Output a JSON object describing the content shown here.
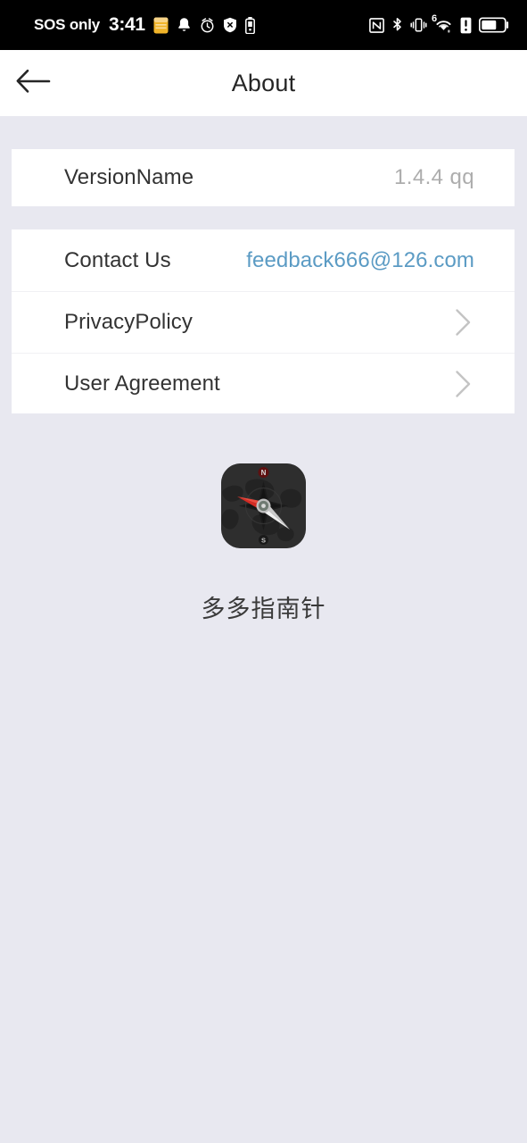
{
  "statusbar": {
    "carrier": "SOS only",
    "time": "3:41",
    "left_icons": [
      "sim-card-icon",
      "bell-icon",
      "alarm-clock-icon",
      "do-not-disturb-icon",
      "battery-saver-icon"
    ],
    "right_icons": [
      "nfc-icon",
      "bluetooth-icon",
      "vibrate-icon",
      "wifi-6-icon",
      "cellular-alert-icon",
      "battery-icon"
    ],
    "wifi_generation": "6"
  },
  "header": {
    "title": "About",
    "back_icon": "arrow-left-icon"
  },
  "version_card": {
    "label": "VersionName",
    "value": "1.4.4  qq"
  },
  "links_card": {
    "rows": [
      {
        "label": "Contact Us",
        "value": "feedback666@126.com",
        "type": "email"
      },
      {
        "label": "PrivacyPolicy",
        "value": "",
        "type": "chevron"
      },
      {
        "label": "User Agreement",
        "value": "",
        "type": "chevron"
      }
    ]
  },
  "app": {
    "name": "多多指南针",
    "icon": "compass-app-icon"
  },
  "colors": {
    "page_background": "#e8e8f0",
    "card_background": "#ffffff",
    "statusbar_background": "#000000",
    "primary_text": "#333333",
    "muted_text": "#adadad",
    "link": "#5b9bc4",
    "chevron": "#c4c4c4",
    "divider": "#f0f0f4"
  }
}
